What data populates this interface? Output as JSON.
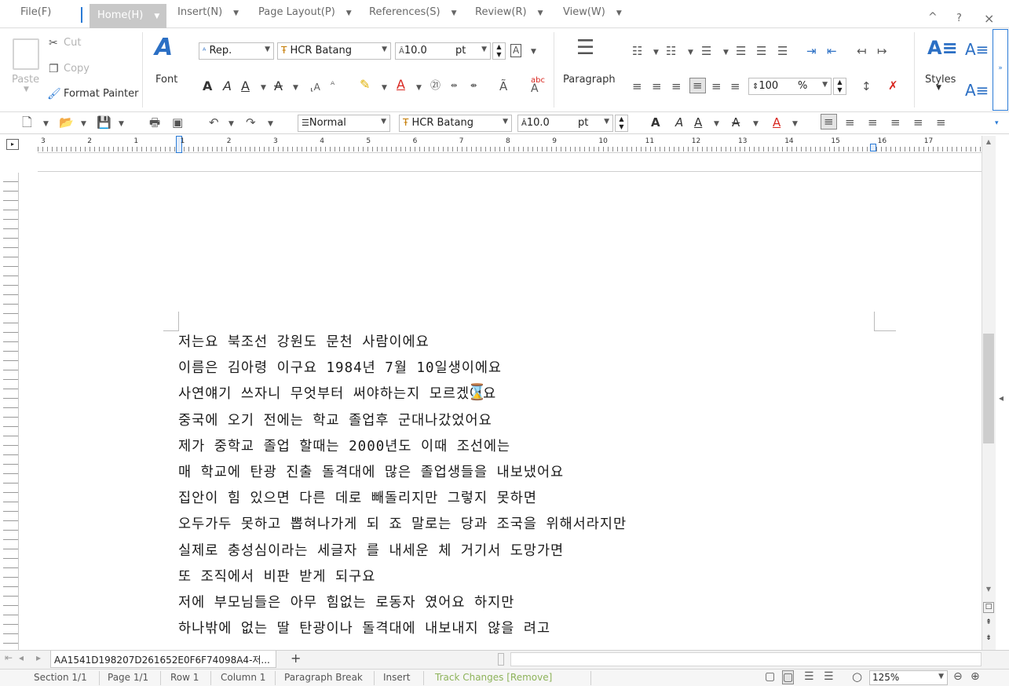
{
  "menu": {
    "file": "File(F)",
    "home": "Home(H)",
    "insert": "Insert(N)",
    "page_layout": "Page Layout(P)",
    "references": "References(S)",
    "review": "Review(R)",
    "view": "View(W)"
  },
  "window_controls": {
    "caret": "^",
    "help": "?",
    "close": "×"
  },
  "ribbon": {
    "paste": "Paste",
    "cut": "Cut",
    "copy": "Copy",
    "format_painter": "Format Painter",
    "font_group": "Font",
    "lang_combo": "Rep.",
    "font_combo": "HCR Batang",
    "size_value": "10.0",
    "size_unit": "pt",
    "paragraph_group": "Paragraph",
    "line_spacing_value": "100",
    "line_spacing_unit": "%",
    "styles_group": "Styles"
  },
  "toolbar": {
    "style_combo": "Normal",
    "font_combo": "HCR Batang",
    "size_value": "10.0",
    "size_unit": "pt"
  },
  "ruler": {
    "numbers": [
      "3",
      "2",
      "1",
      "1",
      "2",
      "3",
      "4",
      "5",
      "6",
      "7",
      "8",
      "9",
      "10",
      "11",
      "12",
      "13",
      "14",
      "15",
      "16",
      "17"
    ]
  },
  "document": {
    "lines": [
      "저는요 북조선 강원도 문천 사람이에요",
      "이름은 김아령 이구요 1984년 7월 10일생이에요",
      "사연얘기 쓰자니 무엇부터 써야하는지 모르겠어요",
      "중국에 오기 전에는 학교 졸업후 군대나갔었어요",
      "제가 중학교 졸업 할때는 2000년도 이때 조선에는",
      "매 학교에 탄광 진출 돌격대에 많은 졸업생들을 내보냈어요",
      "집안이 힘 있으면 다른 데로 빼돌리지만 그렇지 못하면",
      "오두가두 못하고 뽑혀나가게 되 죠 말로는 당과 조국을 위해서라지만",
      "실제로 충성심이라는 세글자 를 내세운 체 거기서 도망가면",
      "또 조직에서 비판 받게 되구요",
      "저에 부모님들은 아무 힘없는 로동자 였어요 하지만",
      "하나밖에 없는 딸 탄광이나 돌격대에 내보내지 않을 려고"
    ]
  },
  "tabs": {
    "document_tab": "AA1541D198207D261652E0F6F74098A4-저...",
    "add": "+"
  },
  "status": {
    "section": "Section 1/1",
    "page": "Page 1/1",
    "row": "Row 1",
    "column": "Column 1",
    "paragraph_break": "Paragraph Break",
    "insert": "Insert",
    "track_changes": "Track Changes [Remove]",
    "zoom": "125%"
  },
  "colors": {
    "accent_blue": "#2b7bd6",
    "home_tab_bg": "#c8c8c8",
    "track_changes_green": "#8db35a"
  }
}
